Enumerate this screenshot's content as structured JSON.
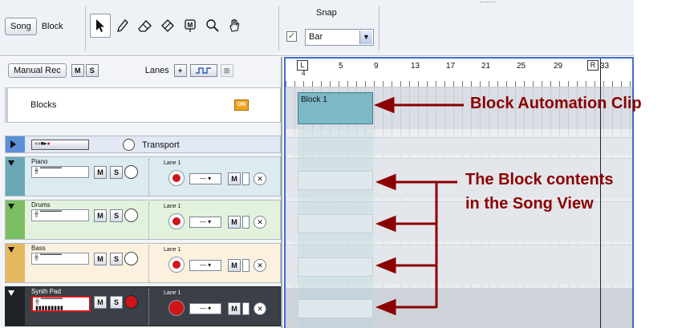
{
  "toolbar": {
    "song_btn": "Song",
    "block_label": "Block",
    "tools": [
      "select-arrow-icon",
      "pencil-icon",
      "eraser-icon",
      "razor-icon",
      "mute-tool-icon",
      "magnify-icon",
      "hand-icon"
    ],
    "snap_label": "Snap",
    "snap_checked": true,
    "snap_value": "Bar"
  },
  "left_header": {
    "manual_rec": "Manual Rec",
    "m": "M",
    "s": "S",
    "lanes_label": "Lanes",
    "plus": "+"
  },
  "blocks_row": {
    "label": "Blocks",
    "on": "ON"
  },
  "tracks": [
    {
      "name": "Transport",
      "kind": "transport"
    },
    {
      "name": "Piano",
      "lane": "Lane 1",
      "color": "#dcebf0"
    },
    {
      "name": "Drums",
      "lane": "Lane 1",
      "color": "#e3f2dc"
    },
    {
      "name": "Bass",
      "lane": "Lane 1",
      "color": "#fbf1de"
    },
    {
      "name": "Synth Pad",
      "lane": "Lane 1",
      "color": "#3b3f46"
    }
  ],
  "ruler": {
    "start_label": "L",
    "end_label": "R",
    "marks": [
      "4",
      "5",
      "9",
      "13",
      "17",
      "21",
      "25",
      "29",
      "33"
    ]
  },
  "clip": {
    "name": "Block 1"
  },
  "callouts": {
    "block_automation": "Block Automation Clip",
    "block_contents_1": "The Block contents",
    "block_contents_2": "in the Song View"
  },
  "colors": {
    "callout": "#8b0000",
    "clip": "#7cb8c6",
    "song_border": "#3f6cd6"
  }
}
